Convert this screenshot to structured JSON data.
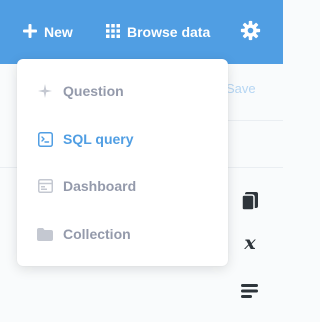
{
  "topbar": {
    "new_label": "New",
    "browse_label": "Browse data",
    "bg_color": "#509ee3"
  },
  "background": {
    "save_label": "Save"
  },
  "menu": {
    "items": [
      {
        "label": "Question",
        "icon": "sparkle-icon",
        "active": false
      },
      {
        "label": "SQL query",
        "icon": "sql-terminal-icon",
        "active": true
      },
      {
        "label": "Dashboard",
        "icon": "dashboard-icon",
        "active": false
      },
      {
        "label": "Collection",
        "icon": "folder-icon",
        "active": false
      }
    ]
  },
  "side_tools": [
    "book-icon",
    "variable-x-icon",
    "snippet-lines-icon"
  ],
  "colors": {
    "accent": "#509ee3",
    "muted": "#949aab",
    "dark_icon": "#2e353b"
  }
}
